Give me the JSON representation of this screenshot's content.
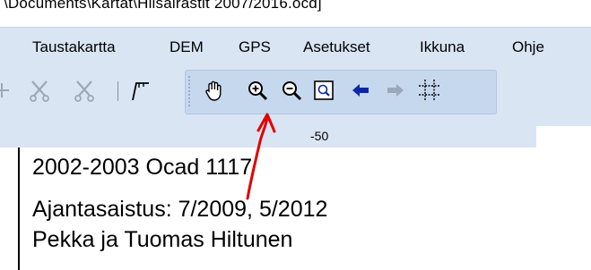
{
  "window": {
    "title_path": "\\Documents\\Kartat\\Hiisalrastit 2007/2016.ocd]"
  },
  "menu": {
    "items": [
      {
        "label": "Taustakartta"
      },
      {
        "label": "DEM"
      },
      {
        "label": "GPS"
      },
      {
        "label": "Asetukset"
      },
      {
        "label": "Ikkuna"
      },
      {
        "label": "Ohje"
      }
    ]
  },
  "toolbar": {
    "icons": [
      "plus-icon",
      "scissors-cut-icon",
      "scissors-cut-icon",
      "pen-line-icon",
      "hand-pan-icon",
      "zoom-in-icon",
      "zoom-out-icon",
      "zoom-window-icon",
      "arrow-back-icon",
      "arrow-forward-icon",
      "grid-icon"
    ],
    "colors": {
      "accent_blue": "#0a2a9c",
      "disabled_gray": "#9ba8b8",
      "annotation_red": "#e00000"
    }
  },
  "ruler": {
    "value": "-50"
  },
  "map": {
    "lines": [
      "2002-2003    Ocad 1117",
      "Ajantasaistus: 7/2009, 5/2012",
      "Pekka ja Tuomas Hiltunen"
    ]
  }
}
